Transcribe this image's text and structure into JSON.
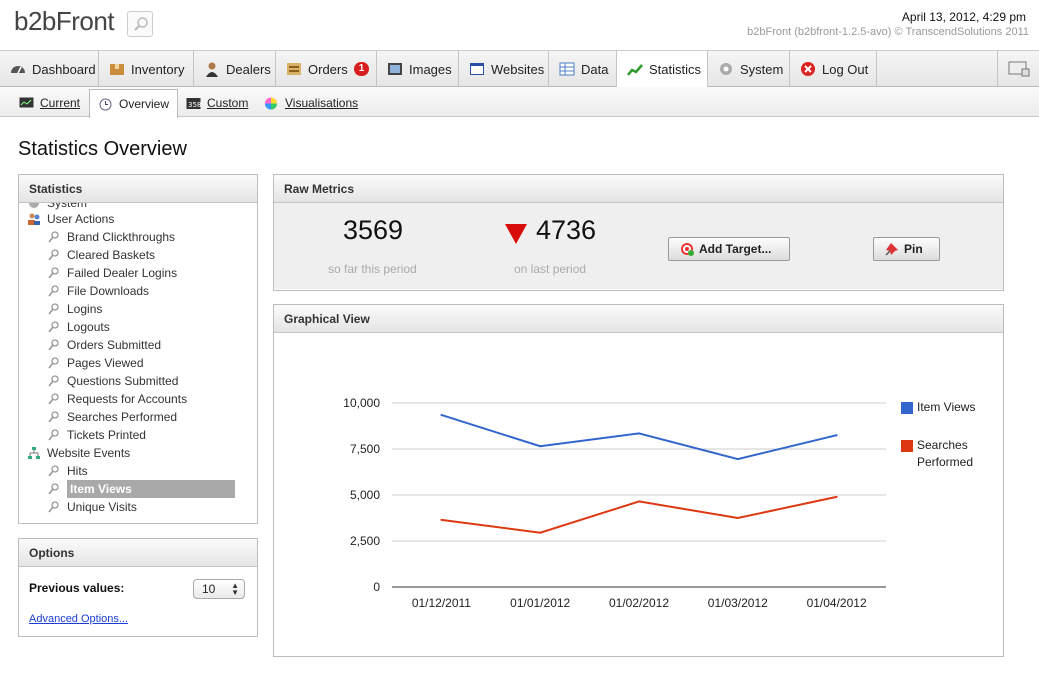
{
  "header": {
    "logo": "b2bFront",
    "datetime": "April 13, 2012, 4:29 pm",
    "version": "b2bFront (b2bfront-1.2.5-avo) © TranscendSolutions 2011"
  },
  "main_tabs": [
    {
      "label": "Dashboard",
      "icon": "speedometer-icon"
    },
    {
      "label": "Inventory",
      "icon": "box-icon"
    },
    {
      "label": "Dealers",
      "icon": "person-icon"
    },
    {
      "label": "Orders",
      "icon": "orders-icon",
      "badge": "1"
    },
    {
      "label": "Images",
      "icon": "image-icon"
    },
    {
      "label": "Websites",
      "icon": "browser-icon"
    },
    {
      "label": "Data",
      "icon": "table-icon"
    },
    {
      "label": "Statistics",
      "icon": "chart-icon",
      "active": true
    },
    {
      "label": "System",
      "icon": "gear-icon"
    },
    {
      "label": "Log Out",
      "icon": "logout-icon"
    }
  ],
  "sub_tabs": [
    {
      "label": "Current",
      "icon": "monitor-icon"
    },
    {
      "label": "Overview",
      "icon": "clock-icon",
      "active": true
    },
    {
      "label": "Custom",
      "icon": "custom-icon"
    },
    {
      "label": "Visualisations",
      "icon": "color-wheel-icon"
    }
  ],
  "page_title": "Statistics Overview",
  "stats_panel": {
    "title": "Statistics",
    "partial_top": "System",
    "groups": [
      {
        "label": "User Actions",
        "items": [
          "Brand Clickthroughs",
          "Cleared Baskets",
          "Failed Dealer Logins",
          "File Downloads",
          "Logins",
          "Logouts",
          "Orders Submitted",
          "Pages Viewed",
          "Questions Submitted",
          "Requests for Accounts",
          "Searches Performed",
          "Tickets Printed"
        ]
      },
      {
        "label": "Website Events",
        "items": [
          "Hits",
          "Item Views",
          "Unique Visits"
        ]
      }
    ],
    "selected": "Item Views"
  },
  "options_panel": {
    "title": "Options",
    "previous_values_label": "Previous values:",
    "previous_values": "10",
    "advanced_link": "Advanced Options..."
  },
  "raw_metrics": {
    "title": "Raw Metrics",
    "current_value": "3569",
    "current_label": "so far this period",
    "last_value": "4736",
    "last_label": "on last period",
    "trend": "down",
    "add_target_label": "Add Target...",
    "pin_label": "Pin"
  },
  "graphical_view": {
    "title": "Graphical View"
  },
  "chart_data": {
    "type": "line",
    "categories": [
      "01/12/2011",
      "01/01/2012",
      "01/02/2012",
      "01/03/2012",
      "01/04/2012"
    ],
    "series": [
      {
        "name": "Item Views",
        "values": [
          9350,
          7650,
          8350,
          6950,
          8250
        ],
        "color": "#3366cc"
      },
      {
        "name": "Searches Performed",
        "values": [
          3650,
          2950,
          4650,
          3750,
          4900
        ],
        "color": "#dc3912"
      }
    ],
    "yticks": [
      "0",
      "2,500",
      "5,000",
      "7,500",
      "10,000"
    ],
    "ylim": [
      0,
      10000
    ],
    "grid": true,
    "legend": "right"
  }
}
